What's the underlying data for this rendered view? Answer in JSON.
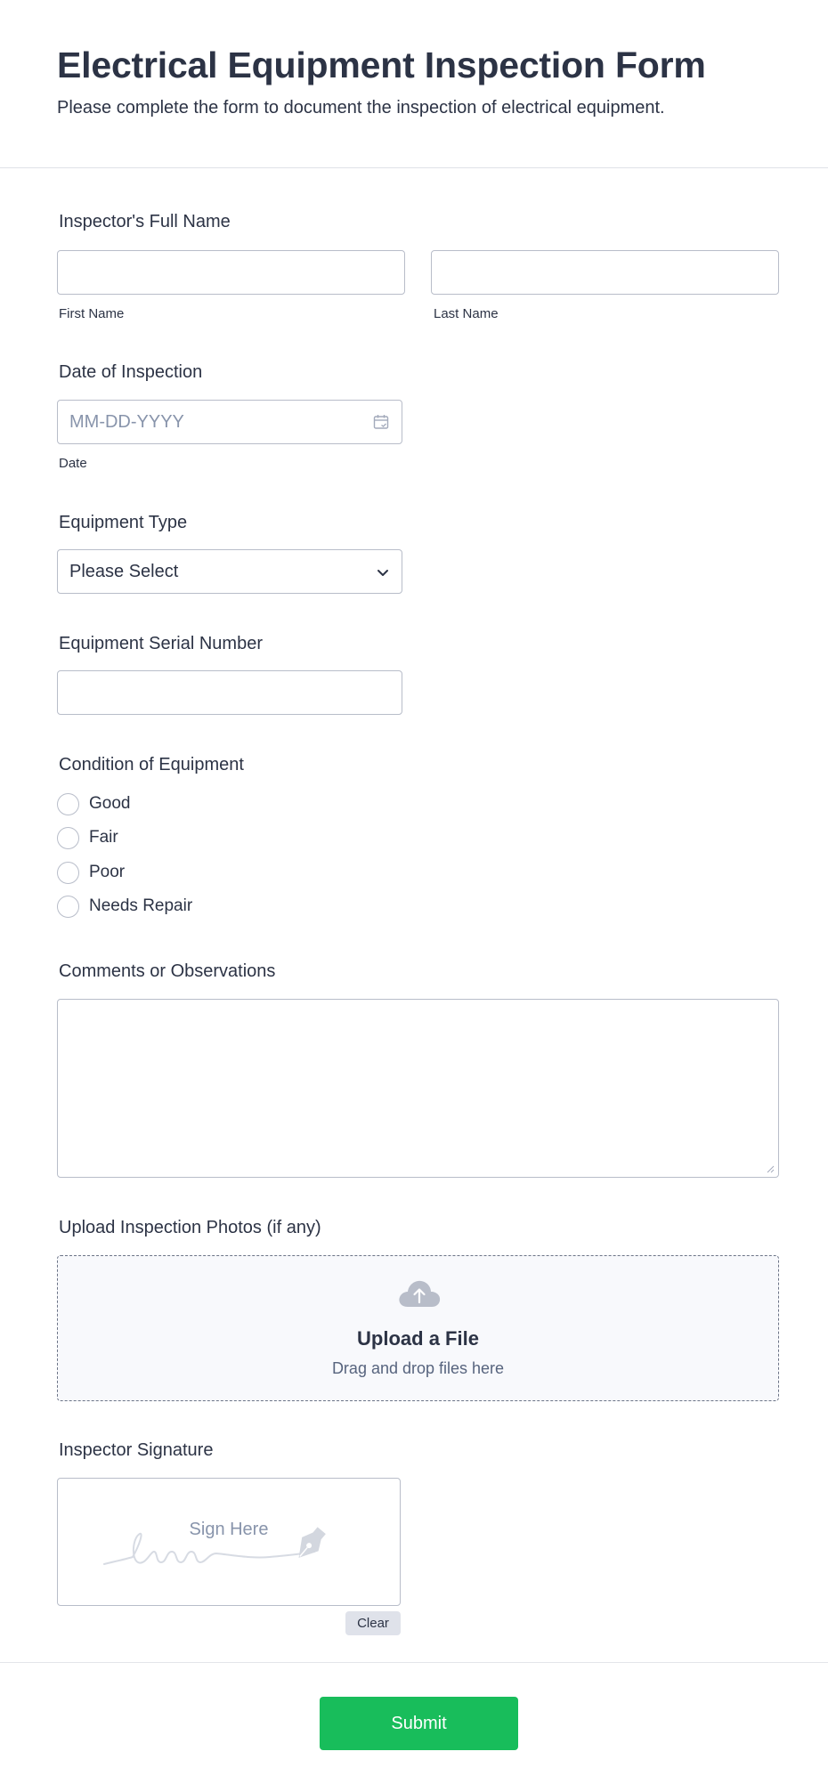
{
  "form": {
    "title": "Electrical Equipment Inspection Form",
    "subtitle": "Please complete the form to document the inspection of electrical equipment."
  },
  "inspector_name": {
    "label": "Inspector's Full Name",
    "first_value": "",
    "last_value": "",
    "first_sublabel": "First Name",
    "last_sublabel": "Last Name"
  },
  "inspection_date": {
    "label": "Date of Inspection",
    "placeholder": "MM-DD-YYYY",
    "sublabel": "Date",
    "icon": "calendar-icon"
  },
  "equipment_type": {
    "label": "Equipment Type",
    "selected": "Please Select",
    "icon": "chevron-down-icon"
  },
  "serial_number": {
    "label": "Equipment Serial Number",
    "value": ""
  },
  "condition": {
    "label": "Condition of Equipment",
    "options": [
      "Good",
      "Fair",
      "Poor",
      "Needs Repair"
    ]
  },
  "comments": {
    "label": "Comments or Observations",
    "value": ""
  },
  "upload": {
    "label": "Upload Inspection Photos (if any)",
    "title": "Upload a File",
    "hint": "Drag and drop files here",
    "icon": "cloud-upload-icon"
  },
  "signature": {
    "label": "Inspector Signature",
    "placeholder": "Sign Here",
    "clear_label": "Clear"
  },
  "submit_label": "Submit",
  "colors": {
    "submit": "#18bd5b",
    "border": "#b8bdc9",
    "text": "#2c3345",
    "placeholder": "#8894ab"
  }
}
